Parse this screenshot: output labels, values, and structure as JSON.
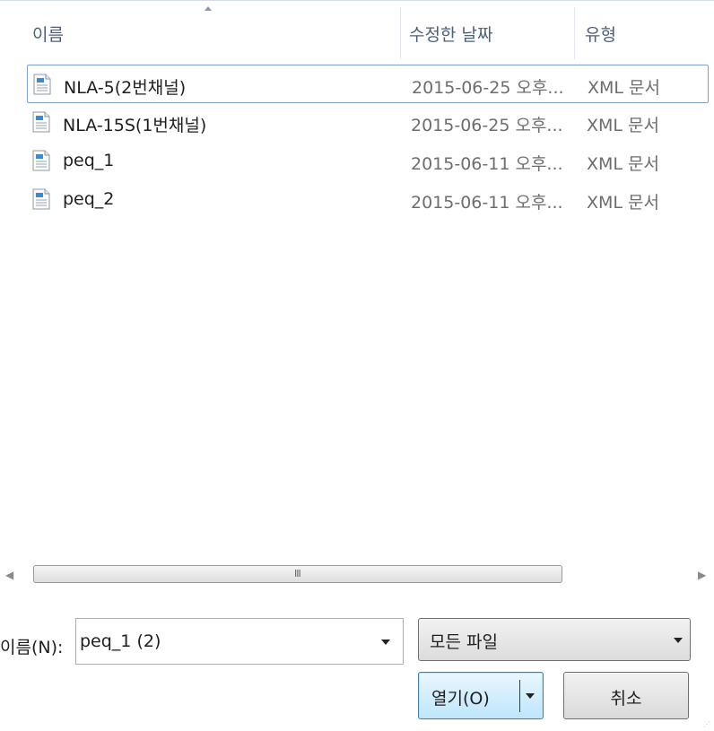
{
  "columns": {
    "name": "이름",
    "date": "수정한 날짜",
    "type": "유형"
  },
  "files": [
    {
      "name": "NLA-5(2번채널)",
      "date": "2015-06-25 오후...",
      "type": "XML 문서",
      "icon": "xml-file-icon",
      "focused": true
    },
    {
      "name": "NLA-15S(1번채널)",
      "date": "2015-06-25 오후...",
      "type": "XML 문서",
      "icon": "xml-file-icon",
      "focused": false
    },
    {
      "name": "peq_1",
      "date": "2015-06-11 오후...",
      "type": "XML 문서",
      "icon": "xml-file-icon",
      "focused": false
    },
    {
      "name": "peq_2",
      "date": "2015-06-11 오후...",
      "type": "XML 문서",
      "icon": "xml-file-icon",
      "focused": false
    }
  ],
  "scrollbar": {
    "left_arrow": "◀",
    "right_arrow": "▶",
    "grip": "III"
  },
  "filename_row": {
    "label": "이름(N):",
    "value": "peq_1 (2)"
  },
  "file_type_filter": {
    "selected": "모든 파일"
  },
  "buttons": {
    "open": "열기(O)",
    "cancel": "취소"
  },
  "colors": {
    "focus_border": "#7da2ce",
    "header_text": "#4c607a",
    "open_button": "#bee6fd"
  }
}
